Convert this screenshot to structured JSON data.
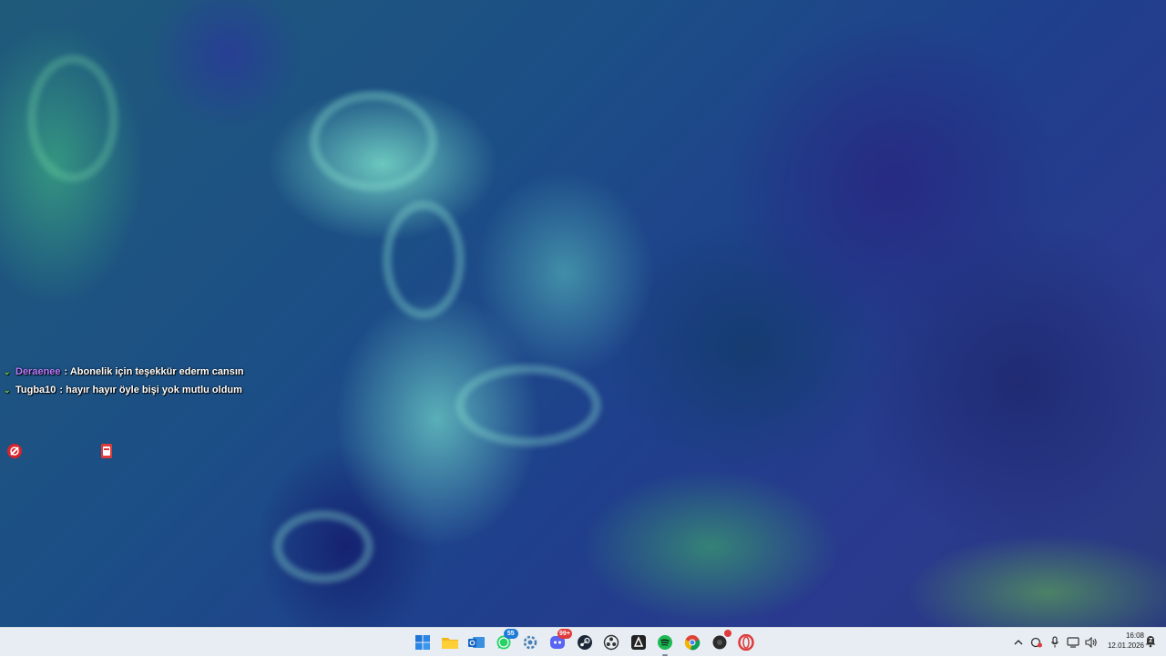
{
  "desktop": {
    "wallpaper": "ocean phytoplankton swirl wallpaper",
    "chat": [
      {
        "user": "Deraenee",
        "user_color": "#b87cff",
        "message": " : Abonelik için teşekkür ederm cansın"
      },
      {
        "user": "Tugba10",
        "user_color": "#ffffff",
        "message": " : hayır hayır öyle bişi yok mutlu oldum"
      }
    ],
    "icons": [
      {
        "name": "opera-gx-icon"
      },
      {
        "name": "app-shortcut-icon"
      }
    ]
  },
  "taskbar": {
    "apps": [
      {
        "name": "start-button",
        "icon": "windows-logo"
      },
      {
        "name": "file-explorer",
        "icon": "folder-icon"
      },
      {
        "name": "outlook",
        "icon": "mail-icon"
      },
      {
        "name": "whatsapp",
        "icon": "whatsapp-icon",
        "badge": "55",
        "badge_color": "#1e7bd8"
      },
      {
        "name": "settings-app",
        "icon": "gear-icon"
      },
      {
        "name": "discord",
        "icon": "discord-icon",
        "badge": "99+",
        "badge_color": "#e03b3b"
      },
      {
        "name": "steam",
        "icon": "steam-icon"
      },
      {
        "name": "obs-studio",
        "icon": "obs-icon"
      },
      {
        "name": "epic-games",
        "icon": "epic-icon"
      },
      {
        "name": "spotify",
        "icon": "spotify-icon",
        "active": true
      },
      {
        "name": "chrome",
        "icon": "chrome-icon"
      },
      {
        "name": "recorder",
        "icon": "record-icon",
        "badge_color": "#e03b3b"
      },
      {
        "name": "opera",
        "icon": "opera-icon"
      }
    ],
    "tray": {
      "icons": [
        "chevron-up-icon",
        "security-icon",
        "microphone-icon",
        "network-icon",
        "volume-icon"
      ],
      "time": "16:08",
      "date": "12.01.2026"
    }
  },
  "colors": {
    "taskbar_bg": "#e7edf2",
    "chat_check": "#7cd63b",
    "accent_red": "#e03b3b"
  }
}
